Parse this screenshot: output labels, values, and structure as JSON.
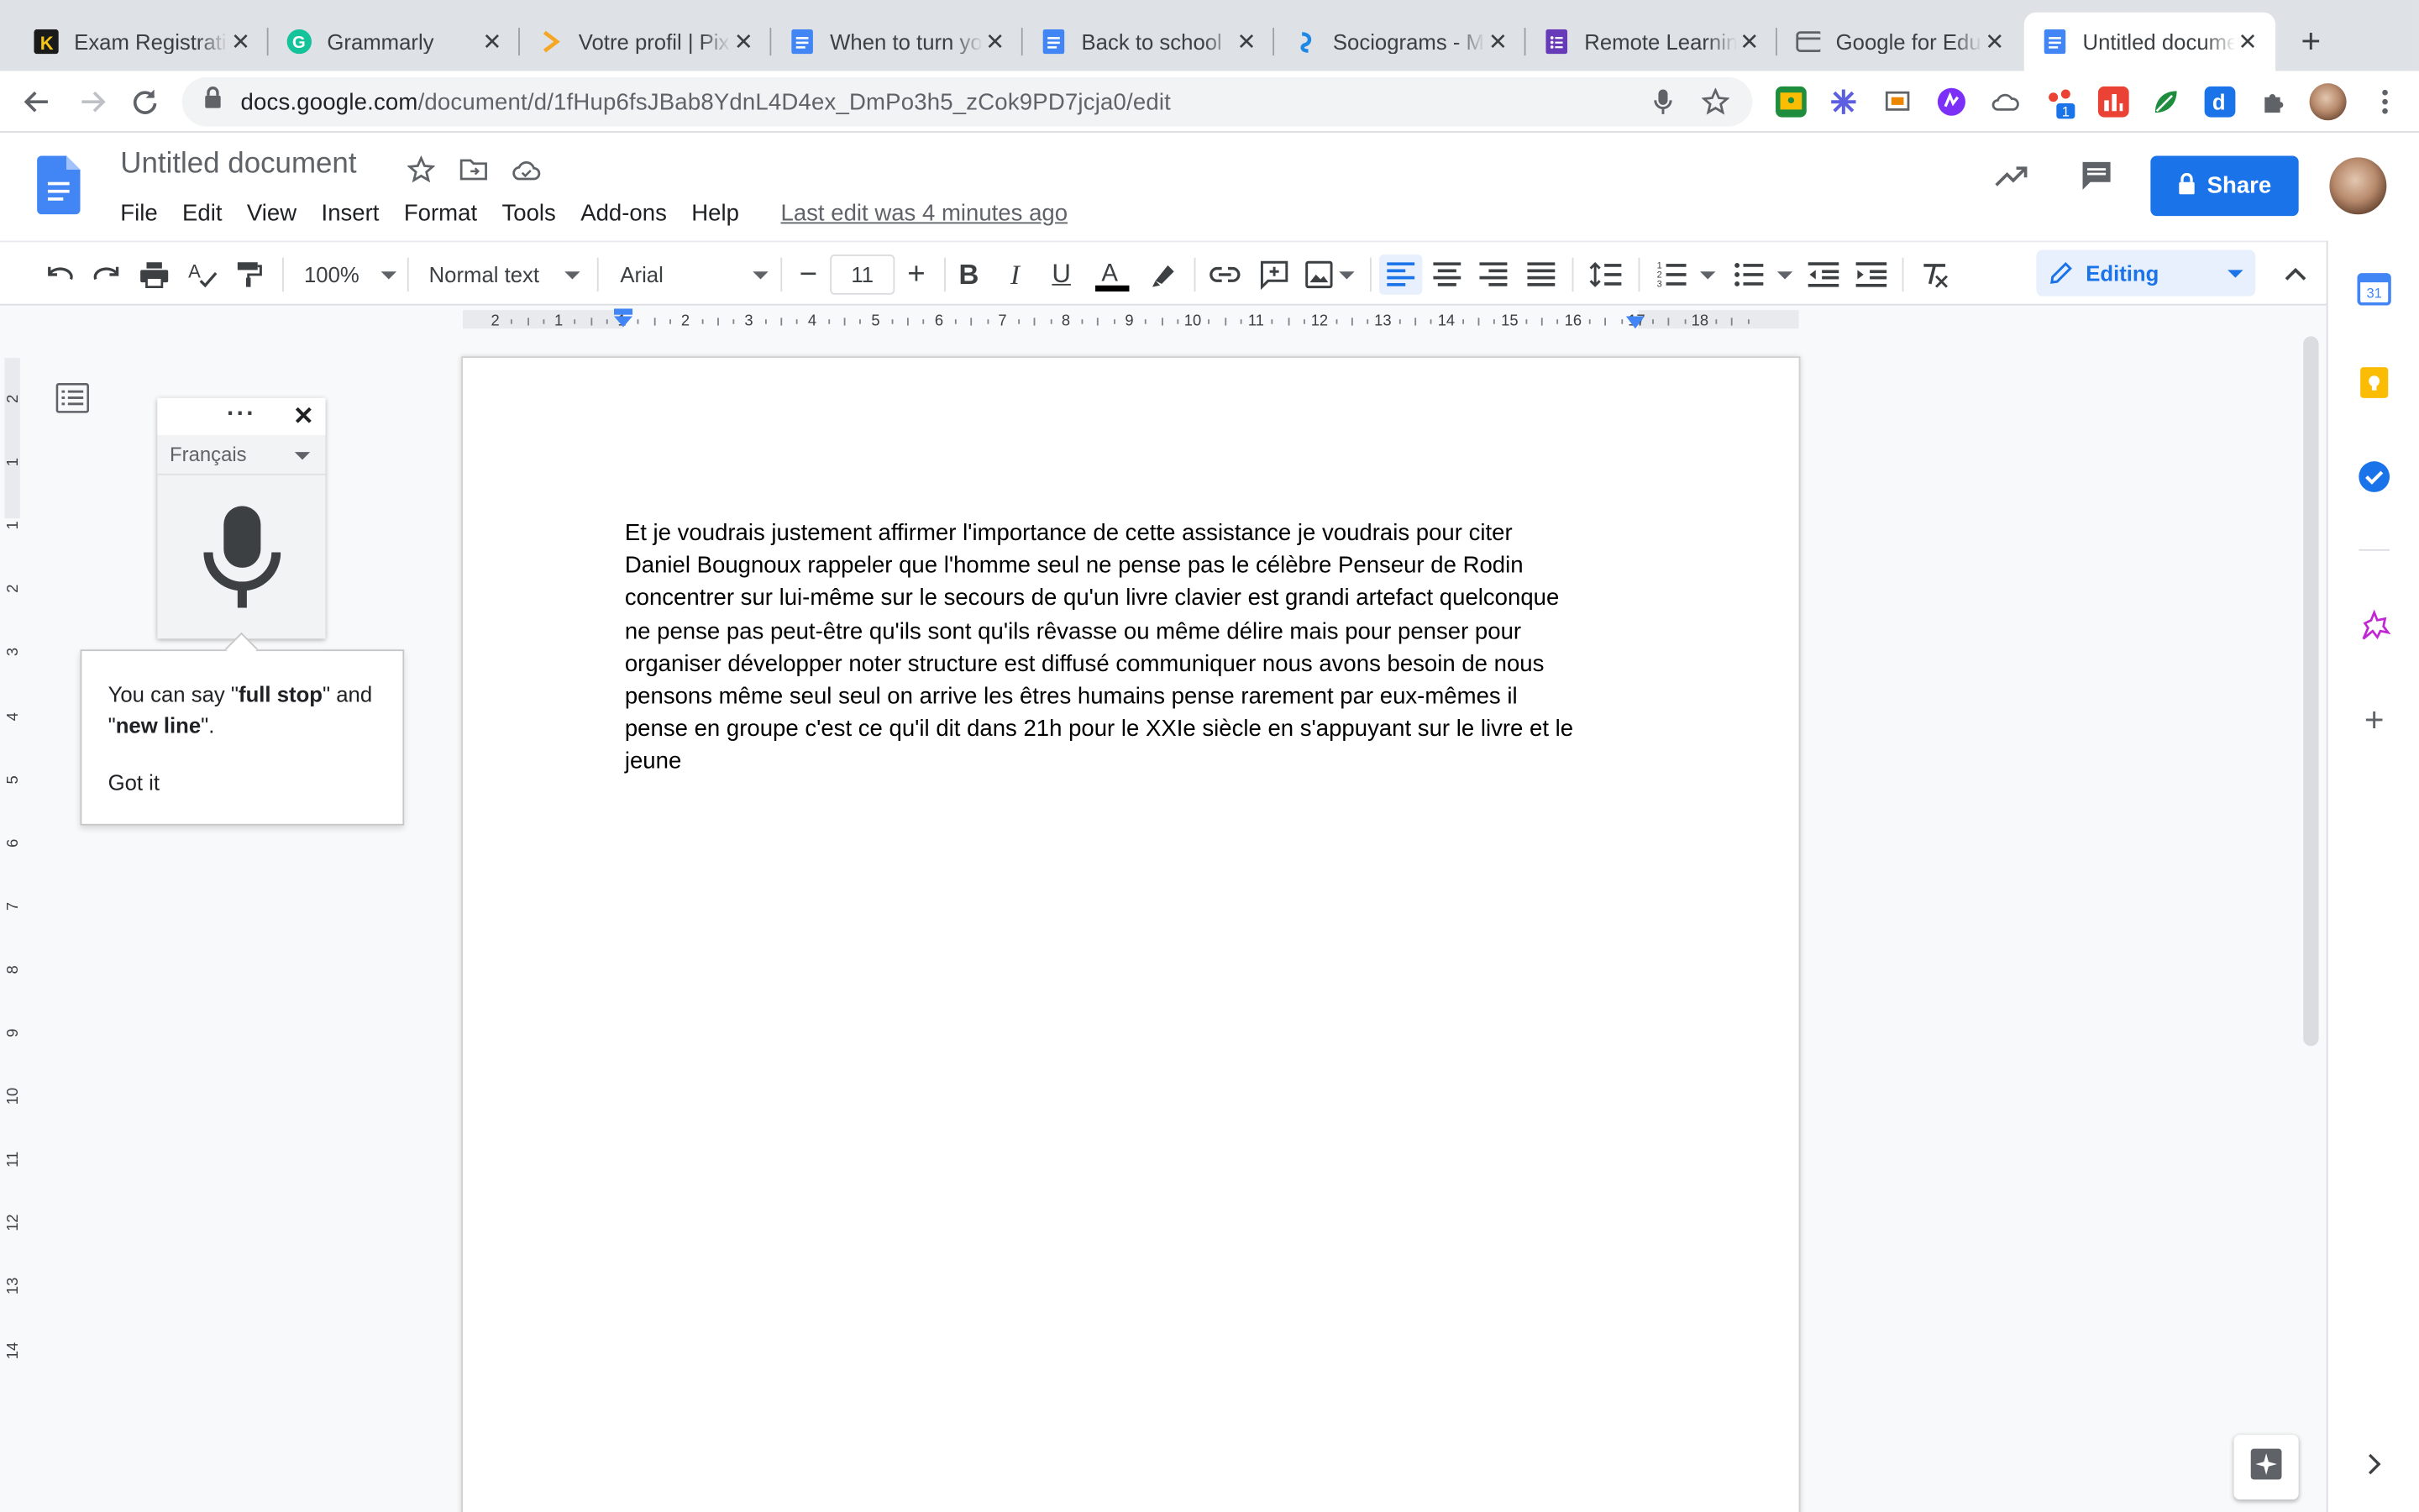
{
  "browser": {
    "tabs": [
      {
        "title": "Exam Registration",
        "icon": "k-icon"
      },
      {
        "title": "Grammarly",
        "icon": "grammarly-icon"
      },
      {
        "title": "Votre profil | Pix",
        "icon": "pix-icon"
      },
      {
        "title": "When to turn your",
        "icon": "docs-icon"
      },
      {
        "title": "Back to school",
        "icon": "docs-icon"
      },
      {
        "title": "Sociograms - M",
        "icon": "socio-icon"
      },
      {
        "title": "Remote Learning",
        "icon": "forms-icon"
      },
      {
        "title": "Google for Education",
        "icon": "window-icon"
      },
      {
        "title": "Untitled document",
        "icon": "docs-icon"
      }
    ],
    "url_host": "docs.google.com",
    "url_path": "/document/d/1fHup6fsJBab8YdnL4D4ex_DmPo3h5_zCok9PD7jcja0/edit",
    "extension_badge": "1"
  },
  "docs": {
    "title": "Untitled document",
    "menu": [
      "File",
      "Edit",
      "View",
      "Insert",
      "Format",
      "Tools",
      "Add-ons",
      "Help"
    ],
    "last_edit": "Last edit was 4 minutes ago",
    "share_label": "Share"
  },
  "format_toolbar": {
    "zoom": "100%",
    "style": "Normal text",
    "font": "Arial",
    "font_size": "11",
    "mode": "Editing"
  },
  "ruler": {
    "numbers": [
      "2",
      "1",
      "1",
      "2",
      "3",
      "4",
      "5",
      "6",
      "7",
      "8",
      "9",
      "10",
      "11",
      "12",
      "13",
      "14",
      "15",
      "16",
      "17",
      "18"
    ],
    "vertical": [
      "2",
      "1",
      "1",
      "2",
      "3",
      "4",
      "5",
      "6",
      "7",
      "8",
      "9",
      "10",
      "11",
      "12",
      "13",
      "14"
    ]
  },
  "document": {
    "lines": [
      "Et je voudrais justement affirmer l'importance de cette assistance je voudrais pour citer",
      "Daniel Bougnoux rappeler que l'homme seul ne pense pas le célèbre Penseur de Rodin",
      "concentrer sur lui-même sur le secours de qu'un livre clavier est grandi artefact quelconque",
      "ne pense pas peut-être qu'ils sont qu'ils rêvasse ou même délire mais pour penser pour",
      "organiser développer noter structure est diffusé communiquer nous avons besoin de nous",
      "pensons même seul seul on arrive les êtres humains pense rarement par eux-mêmes il",
      "pense en groupe c'est ce qu'il dit dans 21h pour le XXIe siècle en s'appuyant sur le livre et le",
      "jeune"
    ]
  },
  "voice_typing": {
    "language": "Français",
    "tip_prefix": "You can say \"",
    "tip_cmd1": "full stop",
    "tip_mid": "\" and \"",
    "tip_cmd2": "new line",
    "tip_suffix": "\".",
    "got_it": "Got it"
  },
  "colors": {
    "accent": "#1a73e8",
    "docs_blue": "#4285f4"
  }
}
